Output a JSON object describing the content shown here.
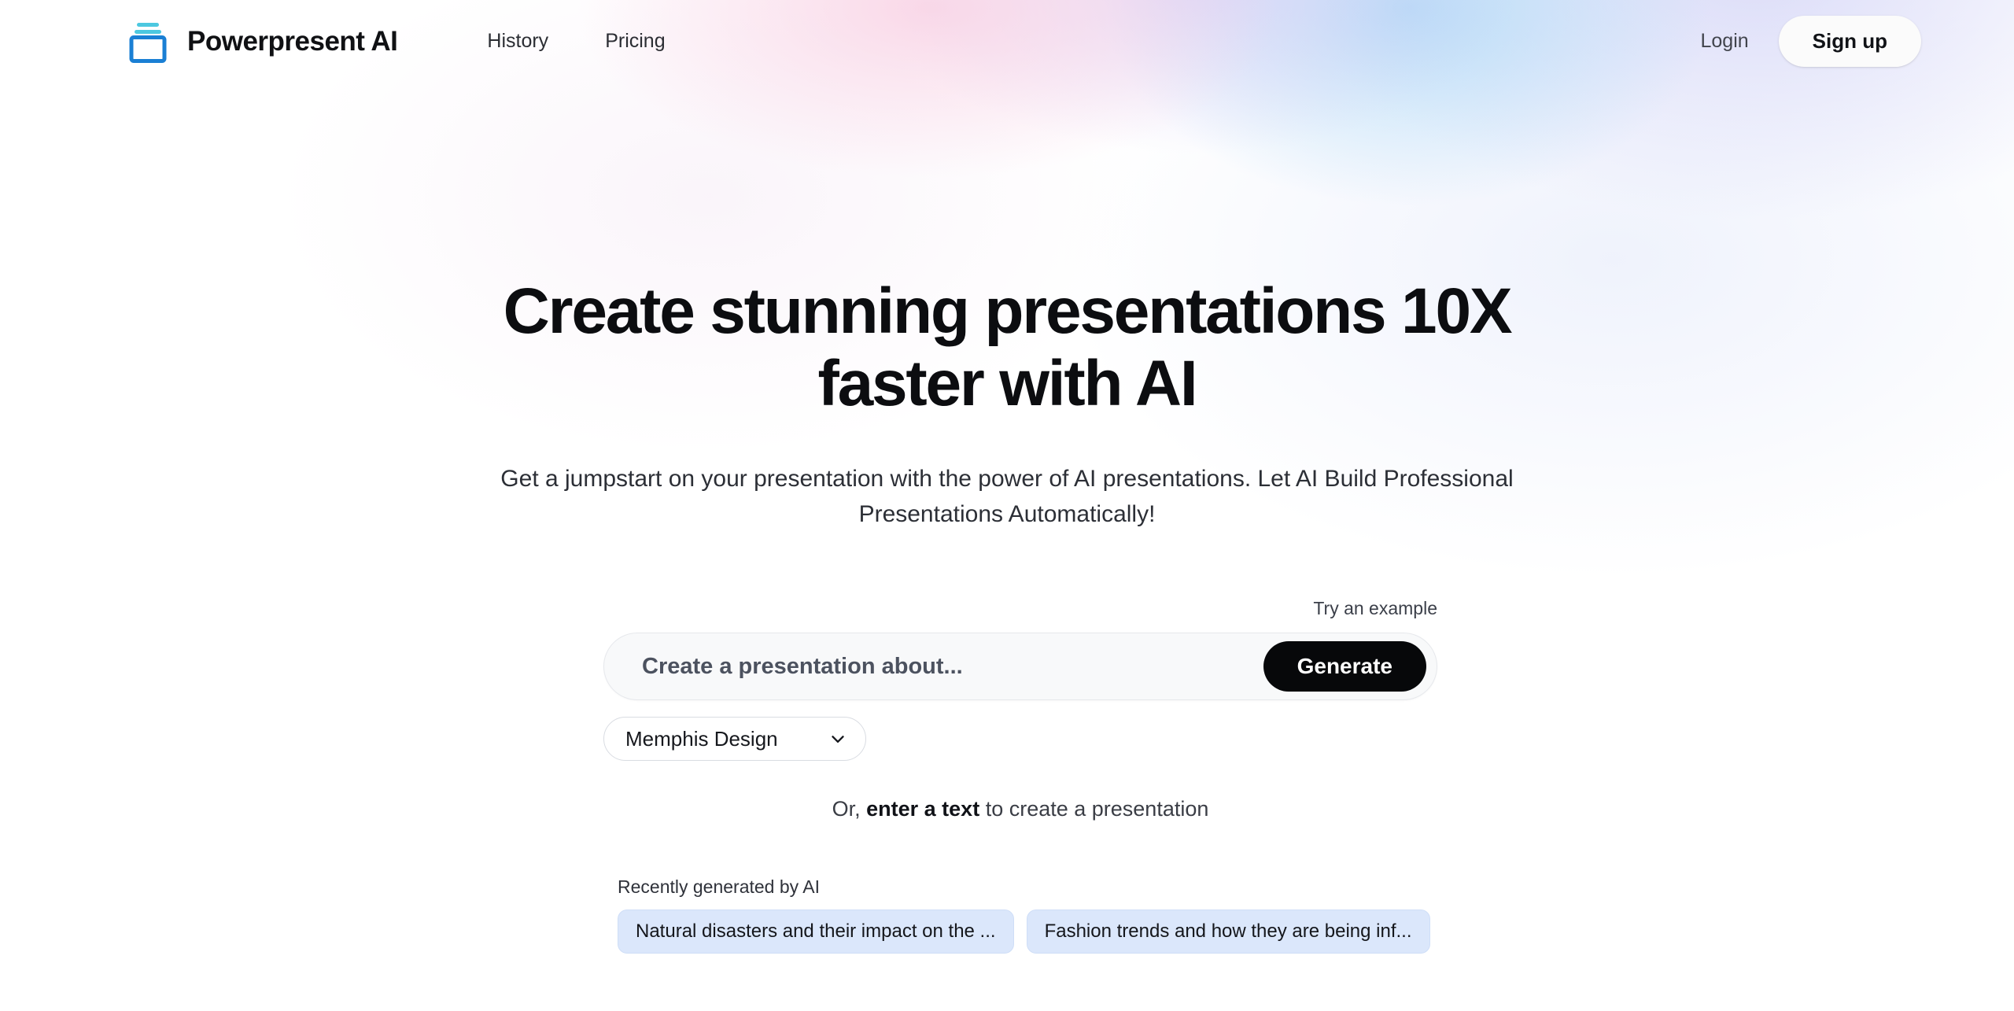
{
  "brand": {
    "name": "Powerpresent AI",
    "icon": "stacked-slides-icon",
    "icon_color_primary": "#1a7fd4",
    "icon_color_secondary": "#4cc8e0"
  },
  "header": {
    "nav": [
      {
        "label": "History"
      },
      {
        "label": "Pricing"
      }
    ],
    "login_label": "Login",
    "signup_label": "Sign up"
  },
  "hero": {
    "title": "Create stunning presentations 10X faster with AI",
    "subtitle": "Get a jumpstart on your presentation with the power of AI presentations. Let AI Build Professional Presentations Automatically!"
  },
  "generator": {
    "try_example_label": "Try an example",
    "prompt_placeholder": "Create a presentation about...",
    "prompt_value": "",
    "generate_label": "Generate",
    "style_selected": "Memphis Design",
    "style_options": [
      "Memphis Design"
    ],
    "chevron_icon": "chevron-down-icon",
    "alt_prefix": "Or, ",
    "alt_link": "enter a text",
    "alt_suffix": " to create a presentation"
  },
  "recent": {
    "label": "Recently generated by AI",
    "chips": [
      {
        "label": "Natural disasters and their impact on the ..."
      },
      {
        "label": "Fashion trends and how they are being inf..."
      }
    ],
    "chip_bg": "#dbe7fb"
  },
  "theme": {
    "page_bg": "#ffffff",
    "accent_dark": "#07080a",
    "text_primary": "#0c0d10",
    "text_secondary": "#2c2f36"
  }
}
